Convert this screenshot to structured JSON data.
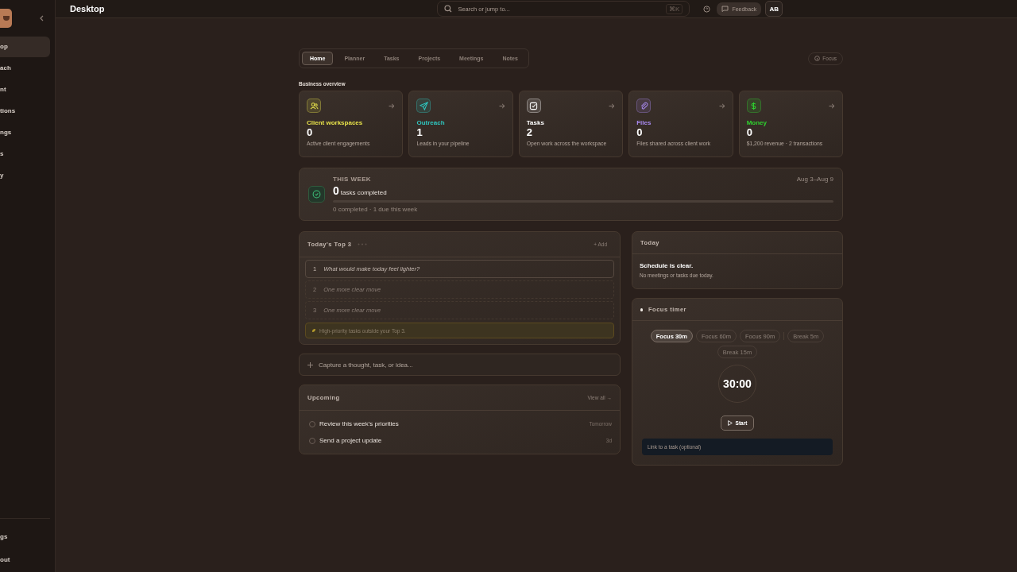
{
  "sidebar": {
    "items": [
      {
        "label": "op",
        "selected": true
      },
      {
        "label": "ach",
        "selected": false
      },
      {
        "label": "nt",
        "selected": false
      },
      {
        "label": "tions",
        "selected": false
      },
      {
        "label": "ngs",
        "selected": false
      },
      {
        "label": "s",
        "selected": false
      },
      {
        "label": "y",
        "selected": false
      }
    ],
    "bottom_items": [
      "gs",
      "out"
    ]
  },
  "header": {
    "title": "Desktop",
    "search": {
      "placeholder": "Search or jump to...",
      "shortcut": "⌘K"
    },
    "feedback": "Feedback",
    "avatar": "AB"
  },
  "tabs": [
    {
      "label": "Home",
      "selected": true
    },
    {
      "label": "Planner",
      "selected": false
    },
    {
      "label": "Tasks",
      "selected": false
    },
    {
      "label": "Projects",
      "selected": false
    },
    {
      "label": "Meetings",
      "selected": false
    },
    {
      "label": "Notes",
      "selected": false
    }
  ],
  "focus_button": "Focus",
  "overview": {
    "title": "Business overview",
    "cards": [
      {
        "kind": "clients",
        "label": "Client workspaces",
        "value": "0",
        "caption": "Active client engagements",
        "color": "#e6e14a"
      },
      {
        "kind": "outreach",
        "label": "Outreach",
        "value": "1",
        "caption": "Leads in your pipeline",
        "color": "#2fc7c0"
      },
      {
        "kind": "tasks",
        "label": "Tasks",
        "value": "2",
        "caption": "Open work across the workspace",
        "color": "#ffffff"
      },
      {
        "kind": "files",
        "label": "Files",
        "value": "0",
        "caption": "Files shared across client work",
        "color": "#a98af0"
      },
      {
        "kind": "money",
        "label": "Money",
        "value": "0",
        "caption": "$1,200 revenue · 2 transactions",
        "color": "#2fd12f"
      }
    ]
  },
  "week": {
    "label": "THIS WEEK",
    "count": "0",
    "count_label": "tasks completed",
    "range": "Aug 3–Aug 9",
    "level": 0,
    "summary": "0 completed · 1 due this week"
  },
  "top3": {
    "title": "Today's Top 3",
    "add": "+ Add",
    "items": [
      {
        "number": "1",
        "placeholder": "What would make today feel lighter?",
        "active": true
      },
      {
        "number": "2",
        "placeholder": "One more clear move",
        "active": false
      },
      {
        "number": "3",
        "placeholder": "One more clear move",
        "active": false
      }
    ],
    "note": "High-priority tasks outside your Top 3."
  },
  "capture": {
    "placeholder": "Capture a thought, task, or idea..."
  },
  "upcoming": {
    "title": "Upcoming",
    "view_all": "View all →",
    "rows": [
      {
        "task": "Review this week's priorities",
        "due": "Tomorrow",
        "checked": false
      },
      {
        "task": "Send a project update",
        "due": "3d",
        "checked": false
      }
    ]
  },
  "today": {
    "title": "Today",
    "heading": "Schedule is clear.",
    "text": "No meetings or tasks due today."
  },
  "focus_timer": {
    "title": "Focus timer",
    "presets": [
      {
        "kind": "focus",
        "label": "Focus 30m",
        "selected": true
      },
      {
        "kind": "focus",
        "label": "Focus 60m",
        "selected": false
      },
      {
        "kind": "focus",
        "label": "Focus 90m",
        "selected": false
      },
      {
        "kind": "break",
        "label": "Break 5m",
        "selected": false
      },
      {
        "kind": "break",
        "label": "Break 15m",
        "selected": false
      }
    ],
    "time": "30:00",
    "start": "Start",
    "link_placeholder": "Link to a task (optional)"
  }
}
